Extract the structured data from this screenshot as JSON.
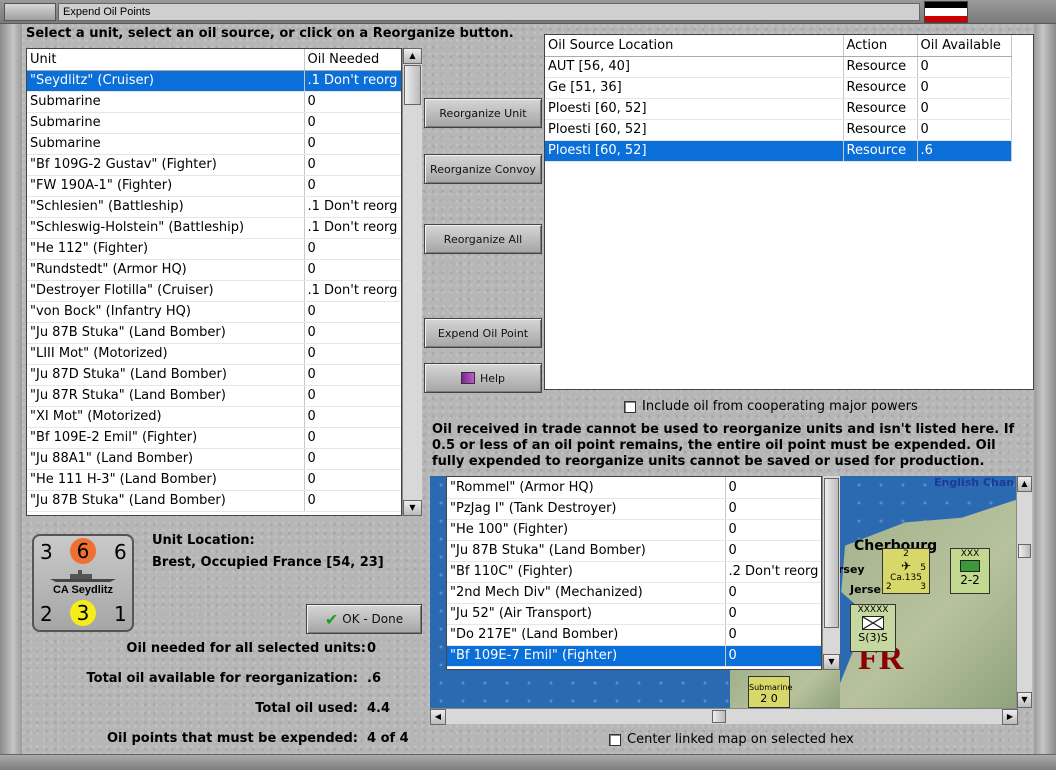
{
  "window": {
    "title": "Expend Oil Points"
  },
  "instruction": "Select a unit, select an oil source, or click on a Reorganize button.",
  "units_table": {
    "columns": [
      "Unit",
      "Oil Needed"
    ],
    "rows": [
      [
        "\"Seydlitz\" (Cruiser)",
        ".1 Don't reorg"
      ],
      [
        "Submarine",
        "0"
      ],
      [
        "Submarine",
        "0"
      ],
      [
        "Submarine",
        "0"
      ],
      [
        "\"Bf 109G-2 Gustav\" (Fighter)",
        "0"
      ],
      [
        "\"FW 190A-1\" (Fighter)",
        "0"
      ],
      [
        "\"Schlesien\" (Battleship)",
        ".1 Don't reorg"
      ],
      [
        "\"Schleswig-Holstein\" (Battleship)",
        ".1 Don't reorg"
      ],
      [
        "\"He 112\" (Fighter)",
        "0"
      ],
      [
        "\"Rundstedt\" (Armor HQ)",
        "0"
      ],
      [
        "\"Destroyer Flotilla\" (Cruiser)",
        ".1 Don't reorg"
      ],
      [
        "\"von Bock\" (Infantry HQ)",
        "0"
      ],
      [
        "\"Ju 87B Stuka\" (Land Bomber)",
        "0"
      ],
      [
        "\"LIII Mot\" (Motorized)",
        "0"
      ],
      [
        "\"Ju 87D Stuka\" (Land Bomber)",
        "0"
      ],
      [
        "\"Ju 87R Stuka\" (Land Bomber)",
        "0"
      ],
      [
        "\"XI Mot\" (Motorized)",
        "0"
      ],
      [
        "\"Bf 109E-2 Emil\" (Fighter)",
        "0"
      ],
      [
        "\"Ju 88A1\" (Land Bomber)",
        "0"
      ],
      [
        "\"He 111 H-3\" (Land Bomber)",
        "0"
      ],
      [
        "\"Ju 87B Stuka\" (Land Bomber)",
        "0"
      ]
    ],
    "selected_index": 0
  },
  "sources_table": {
    "columns": [
      "Oil Source Location",
      "Action",
      "Oil Available"
    ],
    "rows": [
      [
        "AUT [56, 40]",
        "Resource",
        "0"
      ],
      [
        "Ge [51, 36]",
        "Resource",
        "0"
      ],
      [
        "Ploesti [60, 52]",
        "Resource",
        "0"
      ],
      [
        "Ploesti [60, 52]",
        "Resource",
        "0"
      ],
      [
        "Ploesti [60, 52]",
        "Resource",
        ".6"
      ]
    ],
    "selected_index": 4
  },
  "buttons": {
    "reorganize_unit": "Reorganize Unit",
    "reorganize_convoy": "Reorganize Convoy",
    "reorganize_all": "Reorganize All",
    "expend_oil_point": "Expend Oil Point",
    "help": "Help",
    "ok_done": "OK - Done"
  },
  "include_oil_label": "Include oil from cooperating major powers",
  "notice": "Oil received in trade cannot be used to reorganize units and isn't listed here.  If 0.5 or less of an oil point remains, the entire oil point must be expended.   Oil fully expended to reorganize units cannot be saved or used for production.",
  "unit_counter": {
    "top_left": "3",
    "top_mid": "6",
    "top_right": "6",
    "name": "CA Seydlitz",
    "bottom_left": "2",
    "bottom_mid": "3",
    "bottom_right": "1"
  },
  "unit_location": {
    "label": "Unit Location:",
    "value": "Brest, Occupied France [54, 23]"
  },
  "hex_units_table": {
    "rows": [
      [
        "\"Rommel\" (Armor HQ)",
        "0"
      ],
      [
        "\"PzJag I\" (Tank Destroyer)",
        "0"
      ],
      [
        "\"He 100\" (Fighter)",
        "0"
      ],
      [
        "\"Ju 87B Stuka\" (Land Bomber)",
        "0"
      ],
      [
        "\"Bf 110C\" (Fighter)",
        ".2 Don't reorg"
      ],
      [
        "\"2nd Mech Div\" (Mechanized)",
        "0"
      ],
      [
        "\"Ju 52\" (Air Transport)",
        "0"
      ],
      [
        "\"Do 217E\" (Land Bomber)",
        "0"
      ],
      [
        "\"Bf 109E-7 Emil\" (Fighter)",
        "0"
      ]
    ],
    "selected_index": 8
  },
  "summary": {
    "oil_needed_label": "Oil needed for all selected units:",
    "oil_needed_value": "0",
    "total_available_label": "Total oil available for reorganization:",
    "total_available_value": ".6",
    "total_used_label": "Total oil used:",
    "total_used_value": "4.4",
    "must_expend_label": "Oil points that must be expended:",
    "must_expend_value": "4 of 4"
  },
  "map": {
    "city": "Cherbourg",
    "sea_label": "English Chan",
    "jersey_a": "rsey",
    "jersey_b": "Jerse",
    "region": "FR",
    "chit_air_label": "Ca.135",
    "chit_air_top": "2",
    "chit_air_right": "5",
    "chit_air_bl": "2",
    "chit_air_br": "3",
    "chit_mech_top": "XXX",
    "chit_mech_value": "2-2",
    "chit_inf_top": "XXXXX",
    "chit_inf_value": "S(3)S",
    "chit_sub_label": "Submarine",
    "chit_sub_value": "2 0"
  },
  "center_map_label": "Center linked map on selected hex",
  "colors": {
    "selection": "#0a6fd9",
    "ok_check": "#1e9e1e",
    "region_label": "#8b0000"
  }
}
